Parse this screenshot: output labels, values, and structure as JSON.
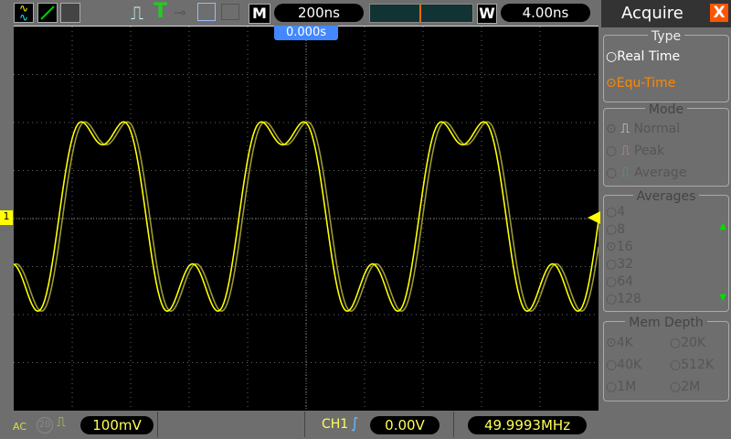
{
  "topbar": {
    "mode_letter": "M",
    "timebase": "200ns",
    "window_letter": "W",
    "window_timebase": "4.00ns",
    "trigger_position": "0.000s"
  },
  "menu": {
    "title": "Acquire",
    "close": "X",
    "type": {
      "label": "Type",
      "options": [
        "Real Time",
        "Equ-Time"
      ],
      "selected": "Equ-Time"
    },
    "mode": {
      "label": "Mode",
      "options": [
        "Normal",
        "Peak",
        "Average"
      ],
      "selected": "Normal"
    },
    "averages": {
      "label": "Averages",
      "options": [
        "4",
        "8",
        "16",
        "32",
        "64",
        "128"
      ],
      "selected": "16"
    },
    "mem_depth": {
      "label": "Mem Depth",
      "options": [
        "4K",
        "20K",
        "40K",
        "512K",
        "1M",
        "2M"
      ],
      "selected": "4K"
    }
  },
  "bottom": {
    "coupling": "AC",
    "bw_limit": "20",
    "volts_div": "100mV",
    "trigger_source": "CH1",
    "trigger_level": "0.00V",
    "frequency": "49.9993MHz"
  },
  "channel_marker": "1",
  "colors": {
    "ch1": "#ffff00",
    "accent": "#ff6600",
    "trig": "#4488ff"
  }
}
